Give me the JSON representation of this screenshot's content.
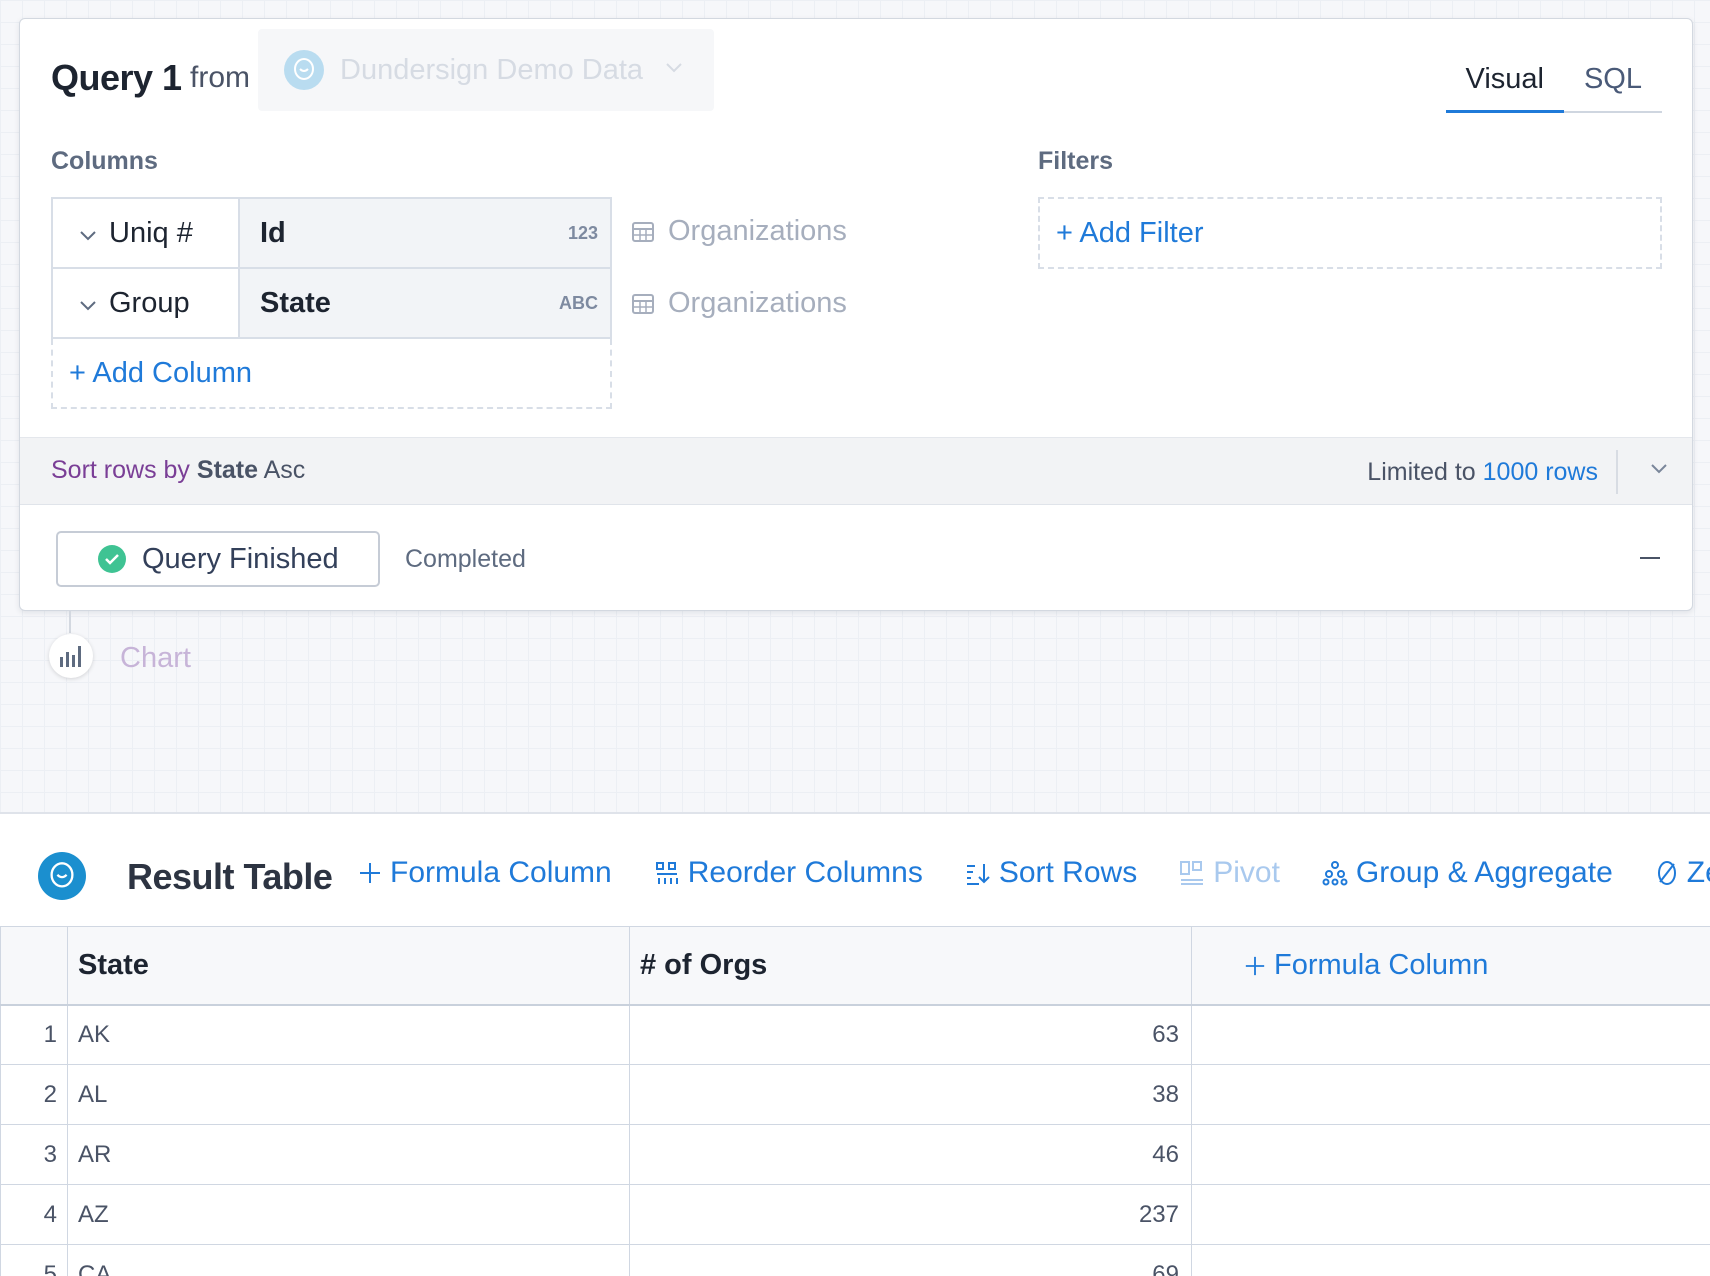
{
  "query": {
    "title": "Query 1",
    "from_label": "from",
    "datasource": "Dundersign Demo Data",
    "tabs": [
      {
        "label": "Visual",
        "active": true
      },
      {
        "label": "SQL",
        "active": false
      }
    ],
    "columns_label": "Columns",
    "filters_label": "Filters",
    "columns": [
      {
        "aggregation": "Uniq #",
        "field": "Id",
        "type": "123",
        "table": "Organizations"
      },
      {
        "aggregation": "Group",
        "field": "State",
        "type": "ABC",
        "table": "Organizations"
      }
    ],
    "add_column": "+ Add Column",
    "add_filter": "+ Add Filter",
    "sort": {
      "prefix": "Sort rows by",
      "field": "State",
      "direction": "Asc"
    },
    "limit": {
      "prefix": "Limited to",
      "value": "1000 rows"
    },
    "status": {
      "button": "Query Finished",
      "text": "Completed"
    }
  },
  "chart_step": {
    "label": "Chart"
  },
  "result": {
    "title": "Result Table",
    "tools": {
      "formula": "Formula Column",
      "reorder": "Reorder Columns",
      "sort": "Sort Rows",
      "pivot": "Pivot",
      "group": "Group & Aggregate",
      "zero": "Ze"
    },
    "headers": {
      "state": "State",
      "orgs": "# of Orgs",
      "add": "Formula Column"
    },
    "rows": [
      {
        "idx": "1",
        "state": "AK",
        "orgs": "63"
      },
      {
        "idx": "2",
        "state": "AL",
        "orgs": "38"
      },
      {
        "idx": "3",
        "state": "AR",
        "orgs": "46"
      },
      {
        "idx": "4",
        "state": "AZ",
        "orgs": "237"
      },
      {
        "idx": "5",
        "state": "CA",
        "orgs": "69"
      }
    ]
  },
  "colors": {
    "accent": "#1f7ad9",
    "success": "#3fc393",
    "sort_label": "#7a3e96"
  }
}
